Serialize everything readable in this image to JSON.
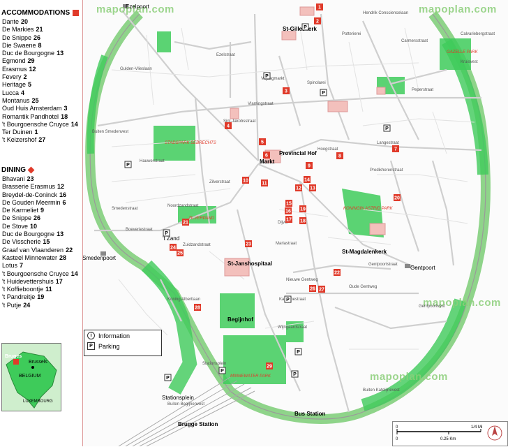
{
  "accommodations": {
    "title": "ACCOMMODATIONS",
    "items": [
      {
        "name": "Dante",
        "num": "20"
      },
      {
        "name": "De Markies",
        "num": "21"
      },
      {
        "name": "De Snippe",
        "num": "26"
      },
      {
        "name": "Die Swaene",
        "num": "8"
      },
      {
        "name": "Duc de Bourgogne",
        "num": "13"
      },
      {
        "name": "Egmond",
        "num": "29"
      },
      {
        "name": "Erasmus",
        "num": "12"
      },
      {
        "name": "Fevery",
        "num": "2"
      },
      {
        "name": "Heritage",
        "num": "5"
      },
      {
        "name": "Lucca",
        "num": "4"
      },
      {
        "name": "Montanus",
        "num": "25"
      },
      {
        "name": "Oud Huis Amsterdam",
        "num": "3"
      },
      {
        "name": "Romantik Pandhotel",
        "num": "18"
      },
      {
        "name": "'t Bourgoensche Cruyce",
        "num": "14"
      },
      {
        "name": "Ter Duinen",
        "num": "1"
      },
      {
        "name": "'t Keizershof",
        "num": "27"
      }
    ]
  },
  "dining": {
    "title": "DINING",
    "items": [
      {
        "name": "Bhavani",
        "num": "23"
      },
      {
        "name": "Brasserie Erasmus",
        "num": "12"
      },
      {
        "name": "Breydel-de-Coninck",
        "num": "16"
      },
      {
        "name": "De Gouden Meermin",
        "num": "6"
      },
      {
        "name": "De Karmeliet",
        "num": "9"
      },
      {
        "name": "De Snippe",
        "num": "26"
      },
      {
        "name": "De Stove",
        "num": "10"
      },
      {
        "name": "Duc de Bourgogne",
        "num": "13"
      },
      {
        "name": "De Visscherie",
        "num": "15"
      },
      {
        "name": "Graaf van Vlaanderen",
        "num": "22"
      },
      {
        "name": "Kasteel Minnewater",
        "num": "28"
      },
      {
        "name": "Lotus",
        "num": "7"
      },
      {
        "name": "'t Bourgoensche Cruyce",
        "num": "14"
      },
      {
        "name": "'t Huidevettershuis",
        "num": "17"
      },
      {
        "name": "'t Koffieboontje",
        "num": "11"
      },
      {
        "name": "'t Pandreitje",
        "num": "19"
      },
      {
        "name": "'t Putje",
        "num": "24"
      }
    ]
  },
  "watermark": "mapoplan.com",
  "legend": {
    "information": "Information",
    "parking": "Parking",
    "info_icon": "i",
    "parking_icon": "P"
  },
  "inset": {
    "brussels": "Brussels",
    "bruges": "Bruges",
    "country": "BELGIUM",
    "lux": "LUXEMBOURG"
  },
  "scale": {
    "mi": "1/4 Mi",
    "zero1": "0",
    "zero2": "0",
    "km": "0.25 Km"
  },
  "map_labels": {
    "gates": [
      "Ezelpoort",
      "Smedenpoort",
      "Gentpoort"
    ],
    "landmarks": [
      "St-Gilleskerk",
      "Provincial Hof",
      "Markt",
      "St-Janshospitaal",
      "St-Magdalenkerk",
      "Begijnhof",
      "Brugge Station",
      "Bus Station",
      "Stationsplein",
      "'t Zand"
    ],
    "parks": [
      "STADSPARK SEBRECHTS",
      "ZILVERPAND",
      "KONINGIN ASTRID PARK",
      "MINNEWATER PARK",
      "GAZELLE PARK"
    ],
    "streets": [
      "Noordzandstraat",
      "Zuidzandstraat",
      "Langestraat",
      "Katelijnestraat",
      "Wijngaardstraat",
      "Boeveriestraat",
      "Gentpoortstraat",
      "Ezelstraat",
      "Vlamingstraat",
      "Hoogstraat",
      "Dijver",
      "Mariastraat",
      "Kruisvest",
      "Gentpoortvest",
      "Buiten Katelijnevest",
      "Buiten Smedenvest",
      "Buiten Begijnenvest",
      "Calvariebergstraat",
      "Hendrik Consciencelaan",
      "Gulden-Vlieslaan",
      "Koning Albertlaan",
      "Stationsplein",
      "Sint-Jakobsstraat",
      "Spinolarei",
      "Potterierei",
      "Carmersstraat",
      "Oude Gentweg",
      "Nieuwe Gentweg",
      "Predikherenstraat",
      "Peperstraat",
      "Vrijdagmarkt",
      "Zilverstraat",
      "Smedenstraat",
      "Hauwerstraat"
    ]
  },
  "markers": [
    "1",
    "2",
    "3",
    "4",
    "5",
    "6",
    "7",
    "8",
    "9",
    "10",
    "11",
    "12",
    "13",
    "14",
    "15",
    "16",
    "17",
    "18",
    "19",
    "20",
    "21",
    "22",
    "23",
    "24",
    "25",
    "26",
    "27",
    "28",
    "29"
  ]
}
